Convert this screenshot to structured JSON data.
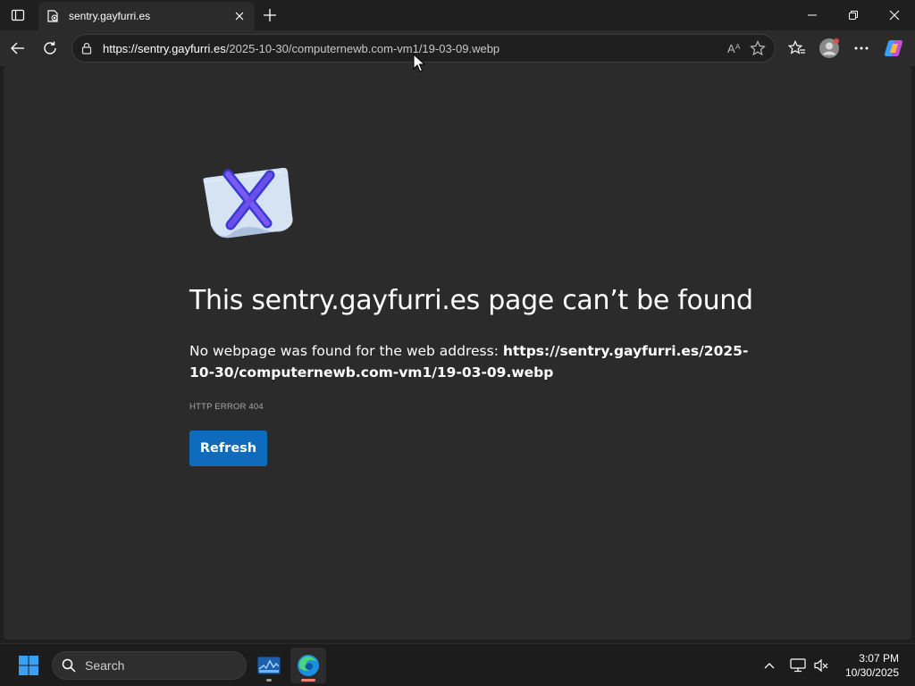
{
  "browser": {
    "tab": {
      "title": "sentry.gayfurri.es"
    },
    "address": {
      "host": "https://sentry.gayfurri.es",
      "path": "/2025-10-30/computernewb.com-vm1/19-03-09.webp"
    },
    "icons": [
      "tab-actions-icon",
      "favicon-icon",
      "close-icon",
      "plus-icon",
      "minimize-icon",
      "restore-icon",
      "close-window-icon",
      "back-arrow-icon",
      "refresh-icon",
      "lock-icon",
      "read-aloud-icon",
      "star-icon",
      "favorites-icon",
      "profile-icon",
      "more-icon",
      "copilot-icon"
    ]
  },
  "error": {
    "title": "This sentry.gayfurri.es page can’t be found",
    "desc_prefix": "No webpage was found for the web address: ",
    "desc_url": "https://sentry.gayfurri.es/2025-10-30/computernewb.com-vm1/19-03-09.webp",
    "code": "HTTP ERROR 404",
    "refresh_label": "Refresh"
  },
  "taskbar": {
    "search_label": "Search",
    "time": "3:07 PM",
    "date": "10/30/2025"
  },
  "colors": {
    "accent": "#0f6cbd",
    "page_bg": "#2b2b2b",
    "chrome_bg": "#1f1f1f"
  }
}
